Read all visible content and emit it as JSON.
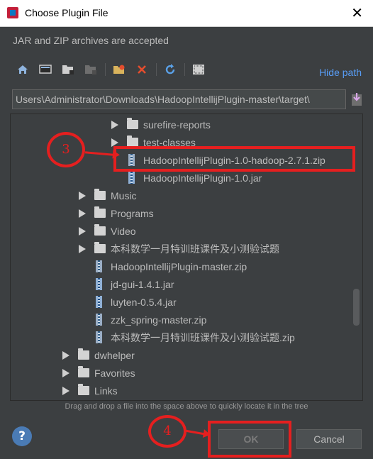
{
  "window": {
    "title": "Choose Plugin File"
  },
  "subtitle": "JAR and ZIP archives are accepted",
  "toolbar": {
    "icons": [
      "home-icon",
      "desktop-icon",
      "project-folder-icon",
      "module-folder-icon",
      "new-folder-icon",
      "delete-icon",
      "refresh-icon",
      "show-hidden-icon"
    ],
    "hide_path_label": "Hide path"
  },
  "path": {
    "value": "\\Users\\Administrator\\Downloads\\HadoopIntellijPlugin-master\\target"
  },
  "tree": {
    "items": [
      {
        "type": "folder",
        "label": "surefire-reports",
        "expandable": true
      },
      {
        "type": "folder",
        "label": "test-classes",
        "expandable": true
      },
      {
        "type": "zip",
        "label": "HadoopIntellijPlugin-1.0-hadoop-2.7.1.zip",
        "selected": true
      },
      {
        "type": "jar",
        "label": "HadoopIntellijPlugin-1.0.jar"
      },
      {
        "type": "folder",
        "label": "Music",
        "expandable": true
      },
      {
        "type": "folder",
        "label": "Programs",
        "expandable": true
      },
      {
        "type": "folder",
        "label": "Video",
        "expandable": true
      },
      {
        "type": "folder",
        "label": "本科数学一月特训班课件及小测验试题",
        "expandable": true
      },
      {
        "type": "zip",
        "label": "HadoopIntellijPlugin-master.zip"
      },
      {
        "type": "jar",
        "label": "jd-gui-1.4.1.jar"
      },
      {
        "type": "jar",
        "label": "luyten-0.5.4.jar"
      },
      {
        "type": "zip",
        "label": "zzk_spring-master.zip"
      },
      {
        "type": "zip",
        "label": "本科数学一月特训班课件及小测验试题.zip"
      },
      {
        "type": "folder",
        "label": "dwhelper",
        "expandable": true
      },
      {
        "type": "folder",
        "label": "Favorites",
        "expandable": true
      },
      {
        "type": "folder",
        "label": "Links",
        "expandable": true
      }
    ]
  },
  "hint": "Drag and drop a file into the space above to quickly locate it in the tree",
  "buttons": {
    "help": "?",
    "ok": "OK",
    "cancel": "Cancel"
  },
  "annotations": {
    "step3": "3",
    "step4": "4"
  },
  "colors": {
    "accent": "#589df6",
    "annotation": "#e51f1f",
    "background": "#3c3f41"
  }
}
